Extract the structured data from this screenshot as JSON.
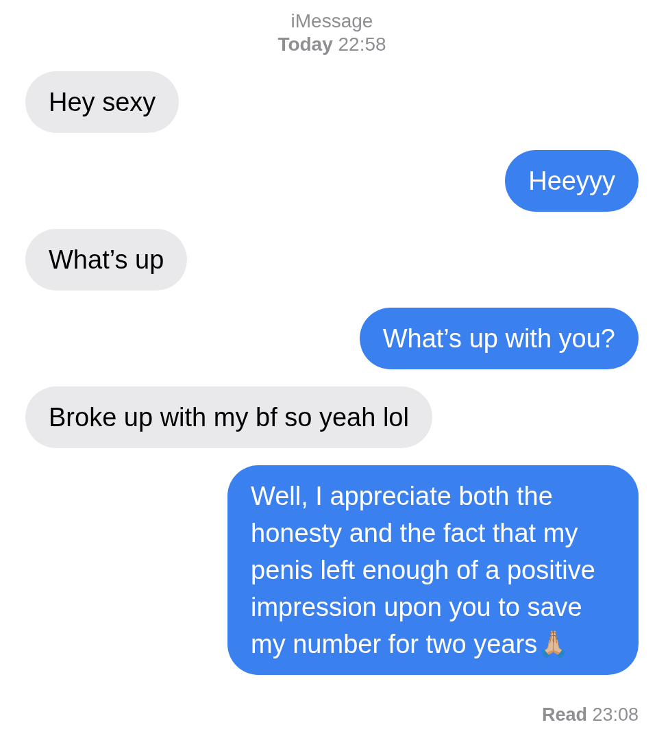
{
  "header": {
    "service": "iMessage",
    "timestamp": "**Today** 22:58"
  },
  "messages": [
    {
      "kind": "received",
      "text": "Hey sexy"
    },
    {
      "kind": "sent",
      "text": "Heeyyy"
    },
    {
      "kind": "received",
      "text": "What’s up"
    },
    {
      "kind": "sent",
      "text": "What’s up with you?"
    },
    {
      "kind": "received",
      "text": "Broke up with my bf so yeah lol"
    },
    {
      "kind": "sent",
      "text": "Well, I appreciate both the honesty and the fact that my penis left enough of a positive impression upon you to save my number for two years🙏🏼"
    }
  ],
  "receipt": "**Read** 23:08"
}
